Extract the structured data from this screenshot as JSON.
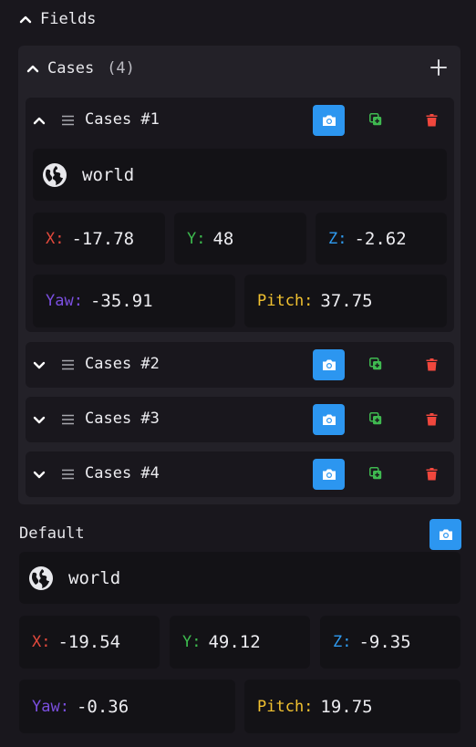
{
  "fields": {
    "title": "Fields"
  },
  "cases": {
    "title": "Cases",
    "count": "(4)",
    "items": [
      {
        "title": "Cases #1",
        "expanded": true,
        "world": "world",
        "x_label": "X:",
        "x": "-17.78",
        "y_label": "Y:",
        "y": "48",
        "z_label": "Z:",
        "z": "-2.62",
        "yaw_label": "Yaw:",
        "yaw": "-35.91",
        "pitch_label": "Pitch:",
        "pitch": "37.75"
      },
      {
        "title": "Cases #2",
        "expanded": false
      },
      {
        "title": "Cases #3",
        "expanded": false
      },
      {
        "title": "Cases #4",
        "expanded": false
      }
    ]
  },
  "default": {
    "title": "Default",
    "world": "world",
    "x_label": "X:",
    "x": "-19.54",
    "y_label": "Y:",
    "y": "49.12",
    "z_label": "Z:",
    "z": "-9.35",
    "yaw_label": "Yaw:",
    "yaw": "-0.36",
    "pitch_label": "Pitch:",
    "pitch": "19.75"
  },
  "colors": {
    "background": "#19171d",
    "panel": "#232128",
    "field": "#131216",
    "accent_blue": "#2c96f0",
    "x_label": "#e2493c",
    "y_label": "#3dbb4e",
    "z_label": "#2f9bf0",
    "yaw_label": "#7b4fe0",
    "pitch_label": "#f2c230",
    "duplicate_icon": "#3fb950",
    "delete_icon": "#f0473d"
  },
  "icons": [
    "chevron-up-icon",
    "chevron-down-icon",
    "plus-icon",
    "drag-handle-icon",
    "camera-icon",
    "duplicate-icon",
    "trash-icon",
    "globe-icon"
  ]
}
